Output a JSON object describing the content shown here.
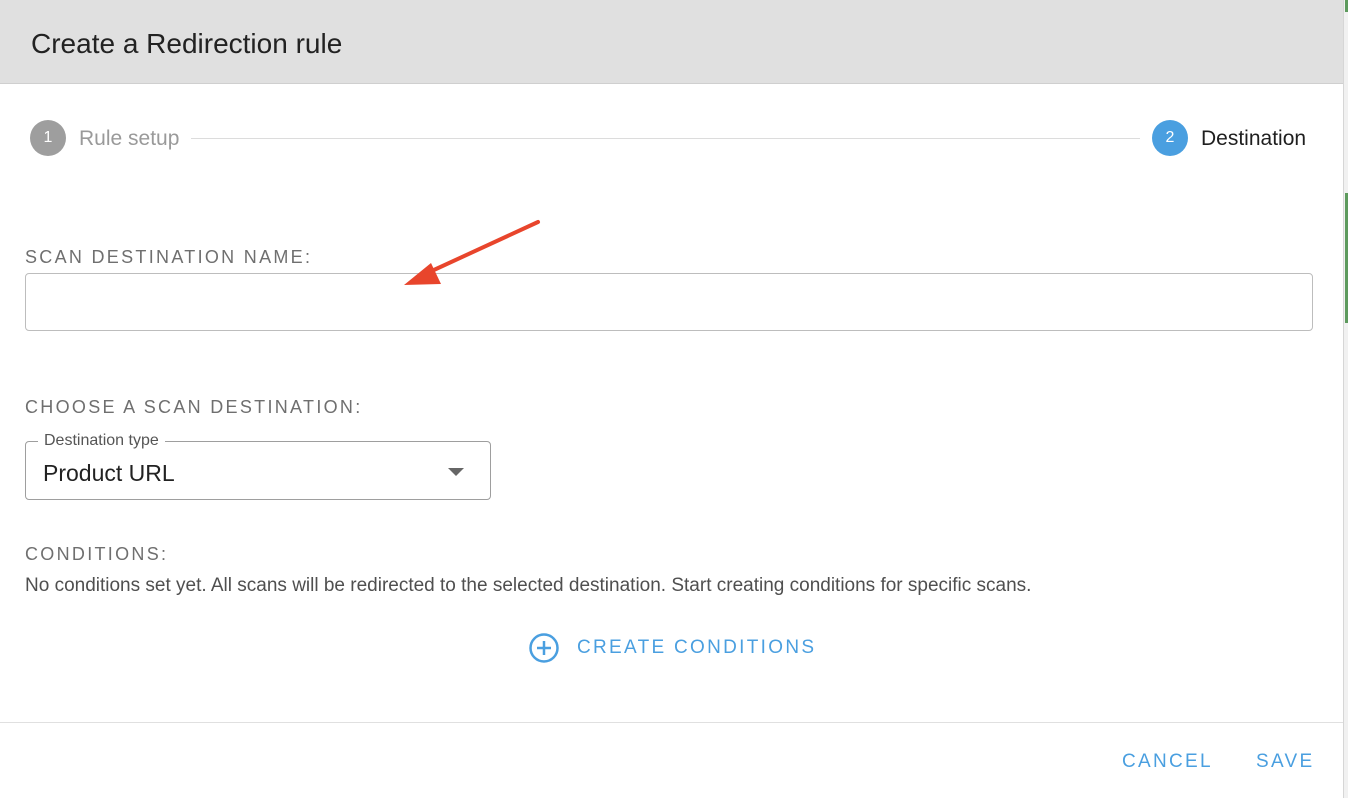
{
  "dialog": {
    "title": "Create a Redirection rule"
  },
  "stepper": {
    "steps": [
      {
        "number": "1",
        "label": "Rule setup",
        "state": "inactive"
      },
      {
        "number": "2",
        "label": "Destination",
        "state": "active"
      }
    ]
  },
  "scan_destination_name": {
    "label": "SCAN DESTINATION NAME:",
    "value": ""
  },
  "scan_destination": {
    "label": "CHOOSE A SCAN DESTINATION:",
    "select_legend": "Destination type",
    "selected_value": "Product URL"
  },
  "conditions": {
    "label": "CONDITIONS:",
    "empty_text": "No conditions set yet. All scans will be redirected to the selected destination. Start creating conditions for specific scans.",
    "create_label": "CREATE CONDITIONS",
    "create_icon": "plus-circle-icon"
  },
  "footer": {
    "cancel_label": "CANCEL",
    "save_label": "SAVE"
  },
  "colors": {
    "accent": "#4a9fe0",
    "step_inactive": "#9e9e9e",
    "header_bg": "#e0e0e0",
    "annotation_arrow": "#e8452c"
  }
}
